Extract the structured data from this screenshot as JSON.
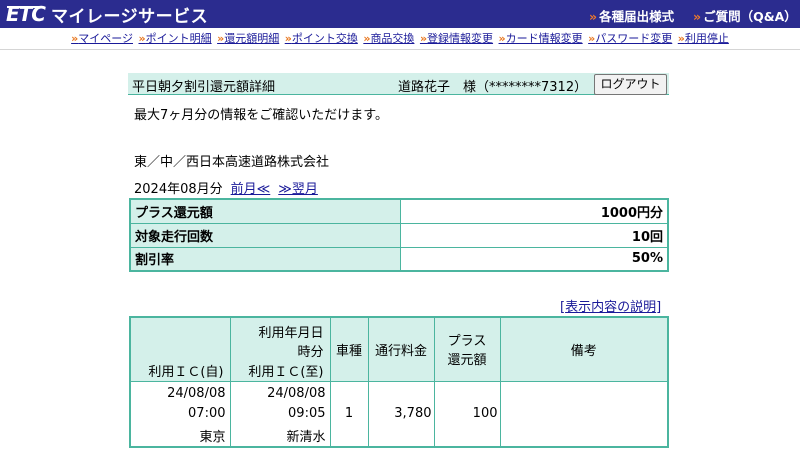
{
  "header": {
    "logo_mark": "ETC",
    "logo_title": "マイレージサービス",
    "links": [
      {
        "arrow": "»",
        "label": "各種届出様式"
      },
      {
        "arrow": "»",
        "label": "ご質問（Q&A）"
      }
    ]
  },
  "nav": {
    "arrow": "»",
    "items": [
      "マイページ",
      "ポイント明細",
      "還元額明細",
      "ポイント交換",
      "商品交換",
      "登録情報変更",
      "カード情報変更",
      "パスワード変更",
      "利用停止"
    ]
  },
  "titlebar": {
    "title": "平日朝夕割引還元額詳細",
    "user": "道路花子　様（********7312）",
    "logout_label": "ログアウト"
  },
  "notice": "最大7ヶ月分の情報をご確認いただけます。",
  "company": "東／中／西日本高速道路株式会社",
  "period": {
    "month": "2024年08月分",
    "prev_label": "前月≪",
    "next_label": "≫翌月"
  },
  "summary": [
    {
      "label": "プラス還元額",
      "value": "1000円分"
    },
    {
      "label": "対象走行回数",
      "value": "10回"
    },
    {
      "label": "割引率",
      "value": "50%"
    }
  ],
  "explain": {
    "open": "[",
    "link": "表示内容の説明",
    "close": "]"
  },
  "detail": {
    "headers": {
      "date": "利用年月日",
      "time": "時分",
      "ic_from": "利用ＩＣ(自)",
      "ic_to": "利用ＩＣ(至)",
      "vehicle": "車種",
      "toll": "通行料金",
      "plus_1": "プラス",
      "plus_2": "還元額",
      "remarks": "備考"
    },
    "rows": [
      {
        "from_date": "24/08/08",
        "from_time": "07:00",
        "from_ic": "東京",
        "to_date": "24/08/08",
        "to_time": "09:05",
        "to_ic": "新清水",
        "vehicle": "1",
        "toll": "3,780",
        "plus": "100",
        "remarks": ""
      }
    ]
  },
  "colors": {
    "header_bg": "#2b2c8f",
    "accent_arrow": "#f07a2a",
    "table_header_bg": "#d4f0ea",
    "table_border": "#4bb59f",
    "link": "#1a1a99"
  }
}
